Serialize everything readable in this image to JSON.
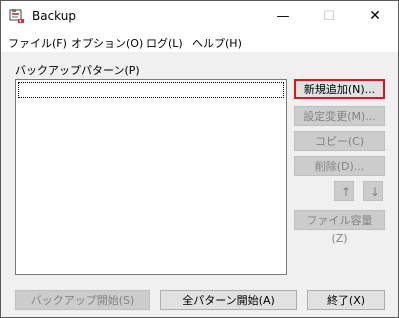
{
  "window": {
    "title": "Backup"
  },
  "window_controls": {
    "minimize": "—",
    "maximize": "☐",
    "close": "✕"
  },
  "menu": [
    {
      "label": "ファイル(F)"
    },
    {
      "label": "オプション(O)"
    },
    {
      "label": "ログ(L)"
    },
    {
      "label": "ヘルプ(H)"
    }
  ],
  "pattern_list": {
    "label": "バックアップパターン(P)",
    "items": []
  },
  "side_buttons": {
    "new": "新規追加(N)...",
    "edit": "設定変更(M)...",
    "copy": "コピー(C)",
    "delete": "削除(D)...",
    "move_up": "↑",
    "move_down": "↓",
    "file_size": "ファイル容量(Z)"
  },
  "bottom_buttons": {
    "start_backup": "バックアップ開始(S)",
    "start_all": "全パターン開始(A)",
    "exit": "終了(X)"
  },
  "colors": {
    "default_button_border": "#e0151b",
    "disabled_text": "#838383"
  },
  "icons": {
    "app": "backup-app-icon"
  }
}
